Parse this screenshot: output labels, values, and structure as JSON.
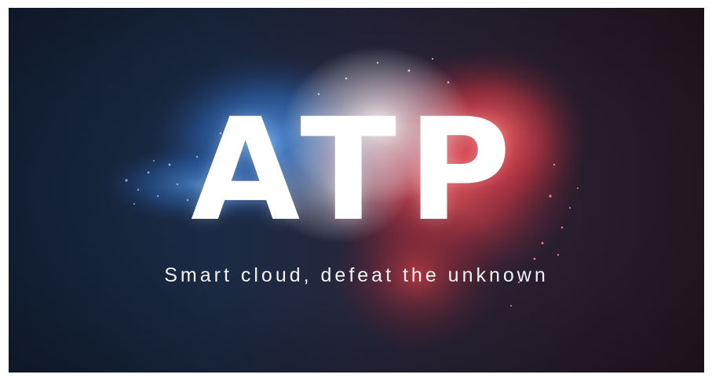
{
  "banner": {
    "logo_text": "ATP",
    "tagline": "Smart cloud, defeat the unknown"
  },
  "colors": {
    "background_left": "#15243d",
    "background_right": "#2a1a26",
    "powder_blue": "#3a7fd0",
    "powder_red": "#e0404a",
    "text": "#ffffff"
  }
}
